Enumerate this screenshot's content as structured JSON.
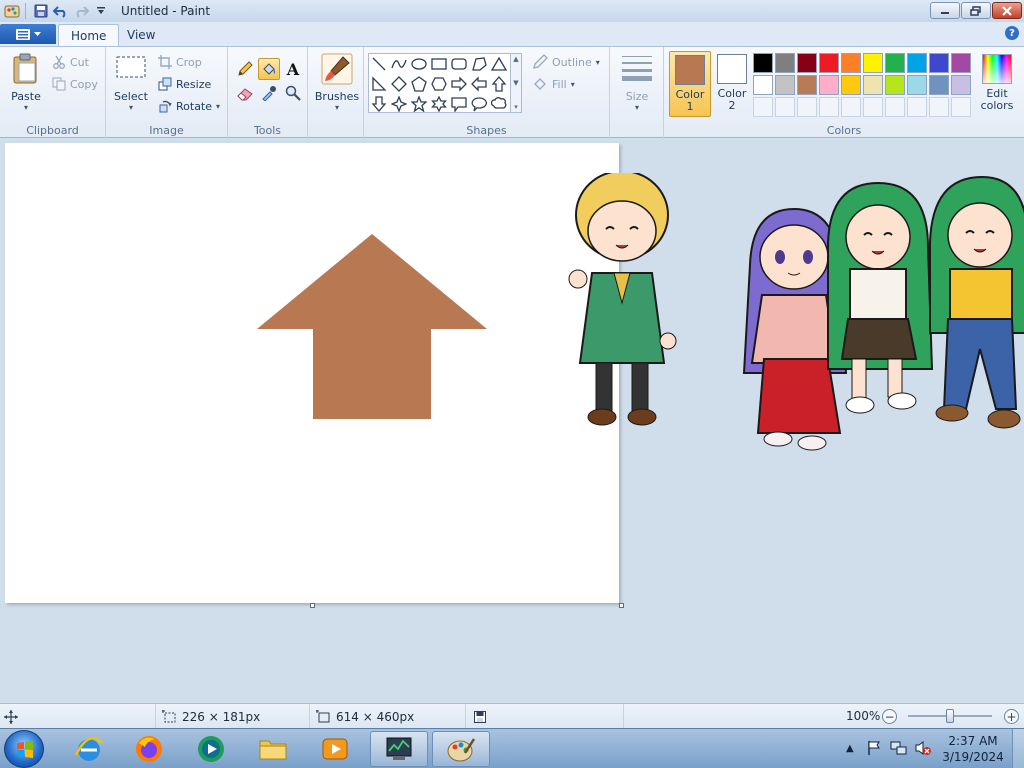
{
  "window": {
    "title": "Untitled - Paint"
  },
  "tabs": [
    {
      "label": "Home"
    },
    {
      "label": "View"
    }
  ],
  "help_label": "?",
  "clipboard": {
    "group_label": "Clipboard",
    "paste_label": "Paste",
    "cut_label": "Cut",
    "copy_label": "Copy"
  },
  "image": {
    "group_label": "Image",
    "select_label": "Select",
    "crop_label": "Crop",
    "resize_label": "Resize",
    "rotate_label": "Rotate"
  },
  "tools": {
    "group_label": "Tools",
    "text_tool_glyph": "A"
  },
  "brushes": {
    "label": "Brushes"
  },
  "shapes": {
    "group_label": "Shapes",
    "outline_label": "Outline",
    "fill_label": "Fill"
  },
  "size": {
    "label": "Size"
  },
  "colors": {
    "group_label": "Colors",
    "color1_label": "Color",
    "color1_num": "1",
    "color2_label": "Color",
    "color2_num": "2",
    "edit_label": "Edit",
    "edit_label2": "colors",
    "color1_value": "#b87852",
    "color2_value": "#ffffff",
    "palette_row1": [
      "#000000",
      "#7f7f7f",
      "#880015",
      "#ed1c24",
      "#ff7f27",
      "#fff200",
      "#22b14c",
      "#00a2e8",
      "#3f48cc",
      "#a349a4"
    ],
    "palette_row2": [
      "#ffffff",
      "#c3c3c3",
      "#b97a57",
      "#ffaec9",
      "#ffc90e",
      "#efe4b0",
      "#b5e61d",
      "#99d9ea",
      "#7092be",
      "#c8bfe7"
    ]
  },
  "canvas": {
    "arrow_color": "#b87852"
  },
  "status": {
    "selection_size": "226 × 181px",
    "canvas_size": "614 × 460px",
    "zoom": "100%"
  },
  "taskbar": {
    "time": "2:37 AM",
    "date": "3/19/2024"
  }
}
